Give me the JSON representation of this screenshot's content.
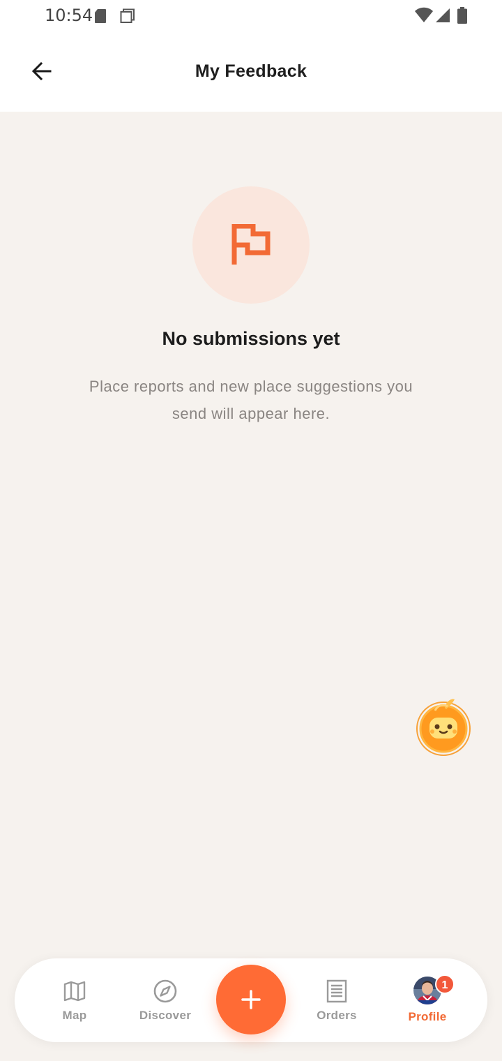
{
  "status_bar": {
    "time": "10:54"
  },
  "header": {
    "title": "My Feedback",
    "back_icon": "arrow-left-icon"
  },
  "empty_state": {
    "icon": "flag-icon",
    "title": "No submissions yet",
    "description": "Place reports and new place suggestions you send will appear here."
  },
  "assistant": {
    "icon": "robot-assistant-icon"
  },
  "bottom_nav": {
    "items": [
      {
        "label": "Map",
        "icon": "map-icon",
        "active": false
      },
      {
        "label": "Discover",
        "icon": "compass-icon",
        "active": false
      },
      {
        "label": "Orders",
        "icon": "receipt-icon",
        "active": false
      },
      {
        "label": "Profile",
        "icon": "avatar",
        "active": true,
        "badge": "1"
      }
    ],
    "fab_icon": "plus-icon"
  },
  "colors": {
    "accent": "#ff6b35",
    "background": "#f6f2ee",
    "icon_circle": "#fae6dd"
  }
}
